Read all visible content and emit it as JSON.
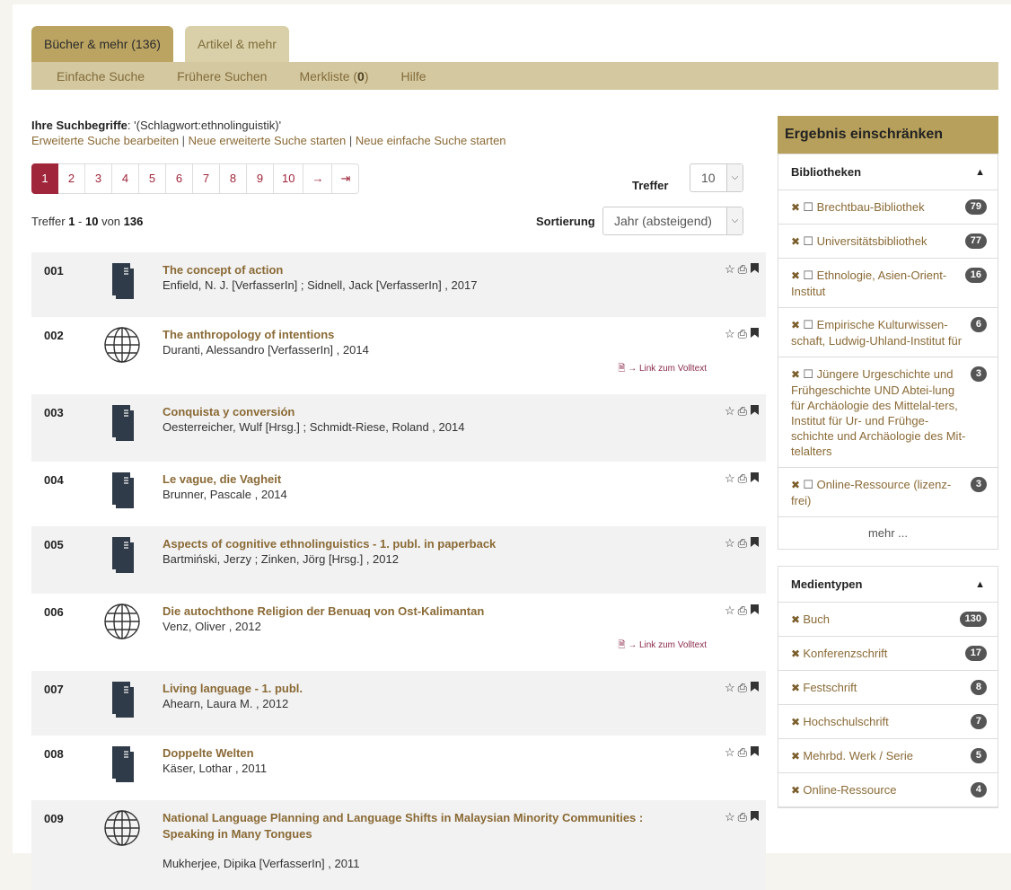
{
  "tabs": {
    "active": "Bücher & mehr (136)",
    "inactive": "Artikel & mehr"
  },
  "subnav": {
    "simple": "Einfache Suche",
    "history": "Frühere Suchen",
    "watchlist_prefix": "Merkliste (",
    "watchlist_count": "0",
    "watchlist_suffix": ")",
    "help": "Hilfe"
  },
  "query": {
    "label": "Ihre Suchbegriffe",
    "terms": ": '(Schlagwort:ethnolinguistik)'",
    "link_edit": "Erweiterte Suche bearbeiten",
    "sep": " | ",
    "link_new_adv": "Neue erweiterte Suche starten",
    "link_new_simple": "Neue einfache Suche starten"
  },
  "pager": [
    "1",
    "2",
    "3",
    "4",
    "5",
    "6",
    "7",
    "8",
    "9",
    "10",
    "→",
    "⇥"
  ],
  "treffer": {
    "label": "Treffer",
    "value": "10"
  },
  "count": {
    "prefix": "Treffer ",
    "from": "1",
    "dash": " - ",
    "to": "10",
    "of": " von ",
    "total": "136"
  },
  "sort": {
    "label": "Sortierung",
    "value": "Jahr (absteigend)"
  },
  "fulltext_label": "→ Link zum Volltext",
  "results": [
    {
      "num": "001",
      "type": "book",
      "title": "The concept of action",
      "author": "Enfield, N. J. [VerfasserIn] ; Sidnell, Jack [VerfasserIn] , 2017",
      "fulltext": false
    },
    {
      "num": "002",
      "type": "online",
      "title": "The anthropology of intentions",
      "author": "Duranti, Alessandro [VerfasserIn] , 2014",
      "fulltext": true
    },
    {
      "num": "003",
      "type": "book",
      "title": "Conquista y conversión",
      "author": "Oesterreicher, Wulf [Hrsg.] ; Schmidt-Riese, Roland , 2014",
      "fulltext": false
    },
    {
      "num": "004",
      "type": "book",
      "title": "Le vague, die Vagheit",
      "author": "Brunner, Pascale , 2014",
      "fulltext": false
    },
    {
      "num": "005",
      "type": "book",
      "title": "Aspects of cognitive ethnolinguistics - 1. publ. in paperback",
      "author": "Bartmiński, Jerzy ; Zinken, Jörg [Hrsg.] , 2012",
      "fulltext": false
    },
    {
      "num": "006",
      "type": "online",
      "title": "Die autochthone Religion der Benuaq von Ost-Kalimantan",
      "author": "Venz, Oliver , 2012",
      "fulltext": true
    },
    {
      "num": "007",
      "type": "book",
      "title": "Living language - 1. publ.",
      "author": "Ahearn, Laura M. , 2012",
      "fulltext": false
    },
    {
      "num": "008",
      "type": "book",
      "title": "Doppelte Welten",
      "author": "Käser, Lothar , 2011",
      "fulltext": false
    },
    {
      "num": "009",
      "type": "online",
      "title": "National Language Planning and Language Shifts in Malaysian Minority Communities : Speaking in Many Tongues",
      "author": "Mukherjee, Dipika [VerfasserIn] , 2011",
      "fulltext": false
    }
  ],
  "sidebar": {
    "title": "Ergebnis einschränken",
    "libraries": {
      "title": "Bibliotheken",
      "items": [
        {
          "label": "Brechtbau-Bibliothek",
          "count": "79"
        },
        {
          "label": "Universitätsbibliothek",
          "count": "77"
        },
        {
          "label": "Ethnologie, Asien-Orient-Institut",
          "count": "16"
        },
        {
          "label": "Empirische Kulturwissen-schaft, Ludwig-Uhland-Institut für",
          "count": "6"
        },
        {
          "label": "Jüngere Urgeschichte und Frühgeschichte UND Abtei-lung für Archäologie des Mittelal-ters, Institut für Ur- und Frühge-schichte und Archäologie des Mit-telalters",
          "count": "3"
        },
        {
          "label": "Online-Ressource (lizenz-frei)",
          "count": "3"
        }
      ],
      "more": "mehr ..."
    },
    "media": {
      "title": "Medientypen",
      "items": [
        {
          "label": "Buch",
          "count": "130"
        },
        {
          "label": "Konferenzschrift",
          "count": "17"
        },
        {
          "label": "Festschrift",
          "count": "8"
        },
        {
          "label": "Hochschulschrift",
          "count": "7"
        },
        {
          "label": "Mehrbd. Werk / Serie",
          "count": "5"
        },
        {
          "label": "Online-Ressource",
          "count": "4"
        }
      ]
    }
  }
}
